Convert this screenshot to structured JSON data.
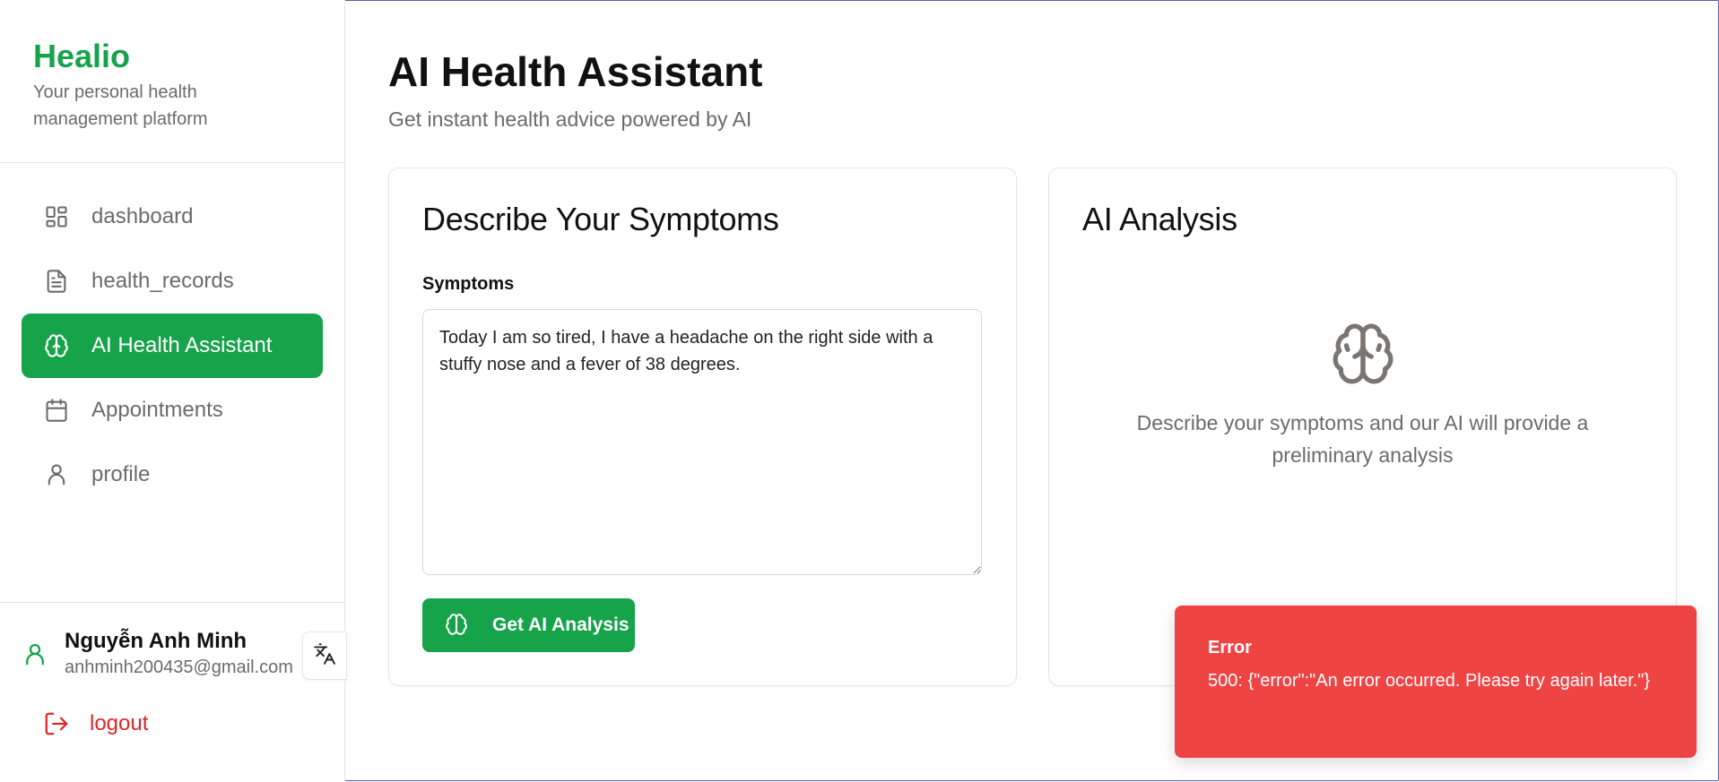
{
  "brand": {
    "name": "Healio",
    "tagline": "Your personal health management platform",
    "accent_color": "#16a34a"
  },
  "nav": {
    "items": [
      {
        "label": "dashboard",
        "icon": "dashboard-grid-icon",
        "active": false
      },
      {
        "label": "health_records",
        "icon": "document-icon",
        "active": false
      },
      {
        "label": "AI Health Assistant",
        "icon": "brain-icon",
        "active": true
      },
      {
        "label": "Appointments",
        "icon": "calendar-icon",
        "active": false
      },
      {
        "label": "profile",
        "icon": "user-icon",
        "active": false
      }
    ]
  },
  "user": {
    "name": "Nguyễn Anh Minh",
    "email": "anhminh200435@gmail.com",
    "language_icon": "translate-icon"
  },
  "logout": {
    "label": "logout",
    "icon": "logout-icon",
    "color": "#dc2626"
  },
  "page": {
    "title": "AI Health Assistant",
    "subtitle": "Get instant health advice powered by AI"
  },
  "symptoms_card": {
    "title": "Describe Your Symptoms",
    "field_label": "Symptoms",
    "field_value": "Today I am so tired, I have a headache on the right side with a stuffy nose and a fever of 38 degrees.",
    "submit_label": "Get AI Analysis"
  },
  "analysis_card": {
    "title": "AI Analysis",
    "empty_icon": "brain-icon",
    "empty_text": "Describe your symptoms and our AI will provide a preliminary analysis"
  },
  "toast": {
    "title": "Error",
    "message": "500: {\"error\":\"An error occurred. Please try again later.\"}",
    "color": "#ef4444"
  }
}
